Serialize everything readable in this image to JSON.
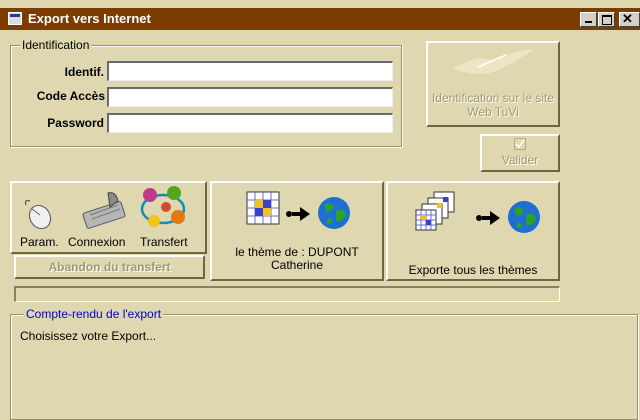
{
  "window": {
    "title": "Export vers Internet"
  },
  "identification": {
    "group_label": "Identification",
    "identif_label": "Identif.",
    "identif_value": "",
    "code_label": "Code Accès",
    "code_value": "",
    "password_label": "Password",
    "password_value": ""
  },
  "site_button": {
    "line1": "Identification sur le site",
    "line2": "Web TuVi"
  },
  "validate_button": {
    "label": "Valider"
  },
  "tools": {
    "param_label": "Param.",
    "connexion_label": "Connexion",
    "transfert_label": "Transfert",
    "abandon_label": "Abandon du transfert"
  },
  "export_theme": {
    "line1": "le thème de : DUPONT",
    "line2": "Catherine"
  },
  "export_all": {
    "label": "Exporte tous les thèmes"
  },
  "report": {
    "group_label": "Compte-rendu de l'export",
    "message": "Choisissez votre Export..."
  },
  "colors": {
    "title_bar": "#7a3c00",
    "window_bg": "#ded7b0",
    "legend_blue": "#0000cc"
  }
}
